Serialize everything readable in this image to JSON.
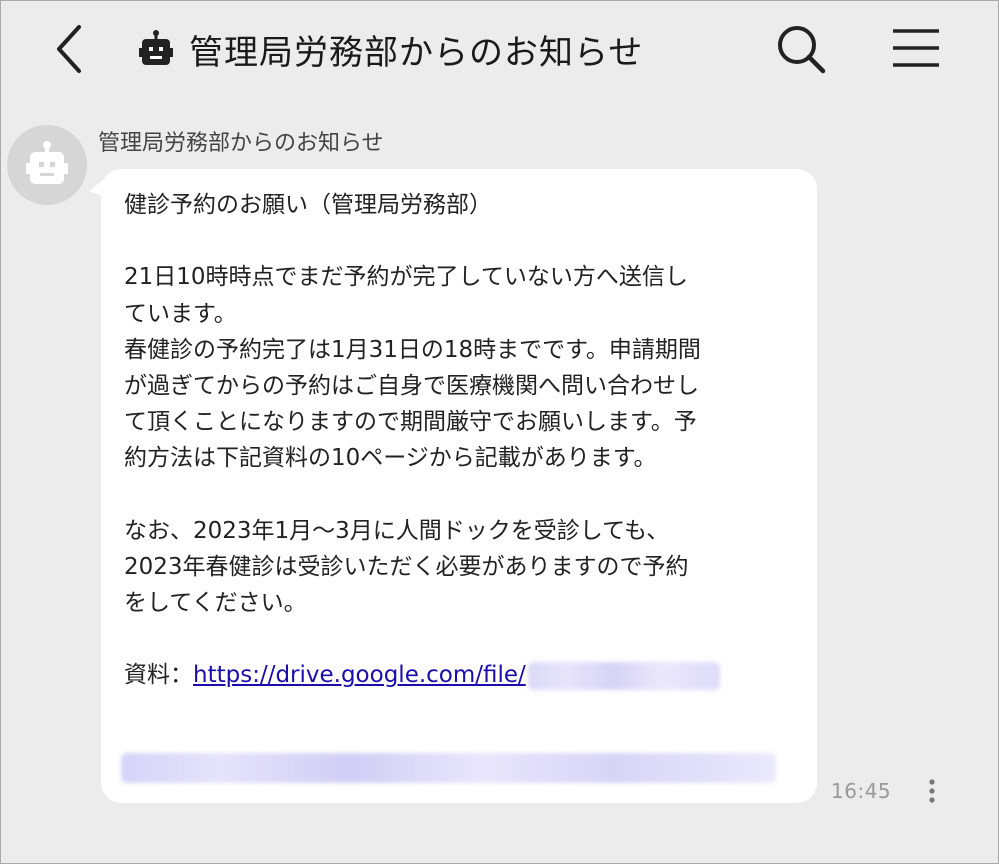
{
  "header": {
    "back_icon": "chevron-left-icon",
    "bot_icon": "bot-icon",
    "title": "管理局労務部からのお知らせ",
    "search_icon": "search-icon",
    "menu_icon": "hamburger-menu-icon"
  },
  "message": {
    "sender": "管理局労務部からのお知らせ",
    "avatar_icon": "bot-icon",
    "lines_block1": [
      "健診予約のお願い（管理局労務部）"
    ],
    "lines_block2": [
      "21日10時時点でまだ予約が完了していない方へ送信し",
      "ています。",
      "春健診の予約完了は1月31日の18時までです。申請期間",
      "が過ぎてからの予約はご自身で医療機関へ問い合わせし",
      "て頂くことになりますので期間厳守でお願いします。予",
      "約方法は下記資料の10ページから記載があります。"
    ],
    "lines_block3": [
      "なお、2023年1月～3月に人間ドックを受診しても、",
      "2023年春健診は受診いただく必要がありますので予約",
      "をしてください。"
    ],
    "resource_label": "資料：",
    "resource_link": "https://drive.google.com/file/",
    "time": "16:45",
    "more_icon": "more-vertical-icon"
  },
  "colors": {
    "background": "#ececec",
    "bubble": "#ffffff",
    "link": "#1a0dab",
    "avatar": "#d6d6d6"
  }
}
